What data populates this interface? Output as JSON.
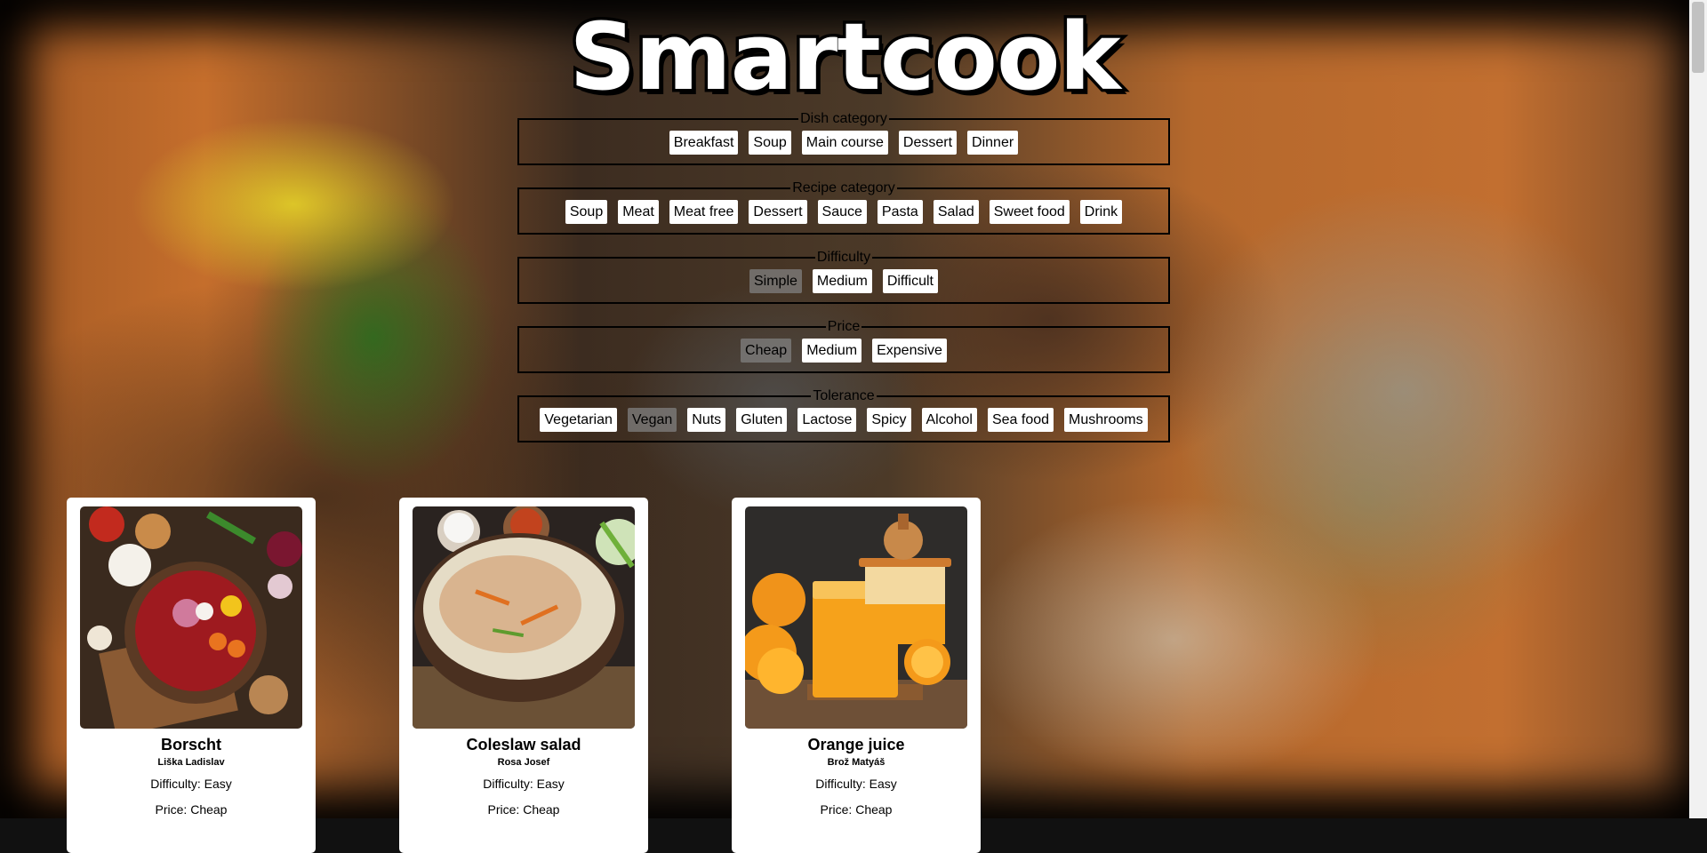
{
  "app": {
    "logo": "Smartcook"
  },
  "filters": {
    "dish_category": {
      "legend": "Dish category",
      "options": [
        "Breakfast",
        "Soup",
        "Main course",
        "Dessert",
        "Dinner"
      ]
    },
    "recipe_category": {
      "legend": "Recipe category",
      "options": [
        "Soup",
        "Meat",
        "Meat free",
        "Dessert",
        "Sauce",
        "Pasta",
        "Salad",
        "Sweet food",
        "Drink"
      ]
    },
    "difficulty": {
      "legend": "Difficulty",
      "options": [
        "Simple",
        "Medium",
        "Difficult"
      ],
      "selected": "Simple"
    },
    "price": {
      "legend": "Price",
      "options": [
        "Cheap",
        "Medium",
        "Expensive"
      ],
      "selected": "Cheap"
    },
    "tolerance": {
      "legend": "Tolerance",
      "options": [
        "Vegetarian",
        "Vegan",
        "Nuts",
        "Gluten",
        "Lactose",
        "Spicy",
        "Alcohol",
        "Sea food",
        "Mushrooms"
      ],
      "selected": "Vegan"
    }
  },
  "recipes": [
    {
      "title": "Borscht",
      "author": "Liška Ladislav",
      "difficulty": "Difficulty: Easy",
      "price": "Price: Cheap"
    },
    {
      "title": "Coleslaw salad",
      "author": "Rosa Josef",
      "difficulty": "Difficulty: Easy",
      "price": "Price: Cheap"
    },
    {
      "title": "Orange juice",
      "author": "Brož Matyáš",
      "difficulty": "Difficulty: Easy",
      "price": "Price: Cheap"
    }
  ],
  "colors": {
    "tag_selected": "#808080",
    "card_bg": "#ffffff",
    "fieldset_border": "#000000"
  }
}
